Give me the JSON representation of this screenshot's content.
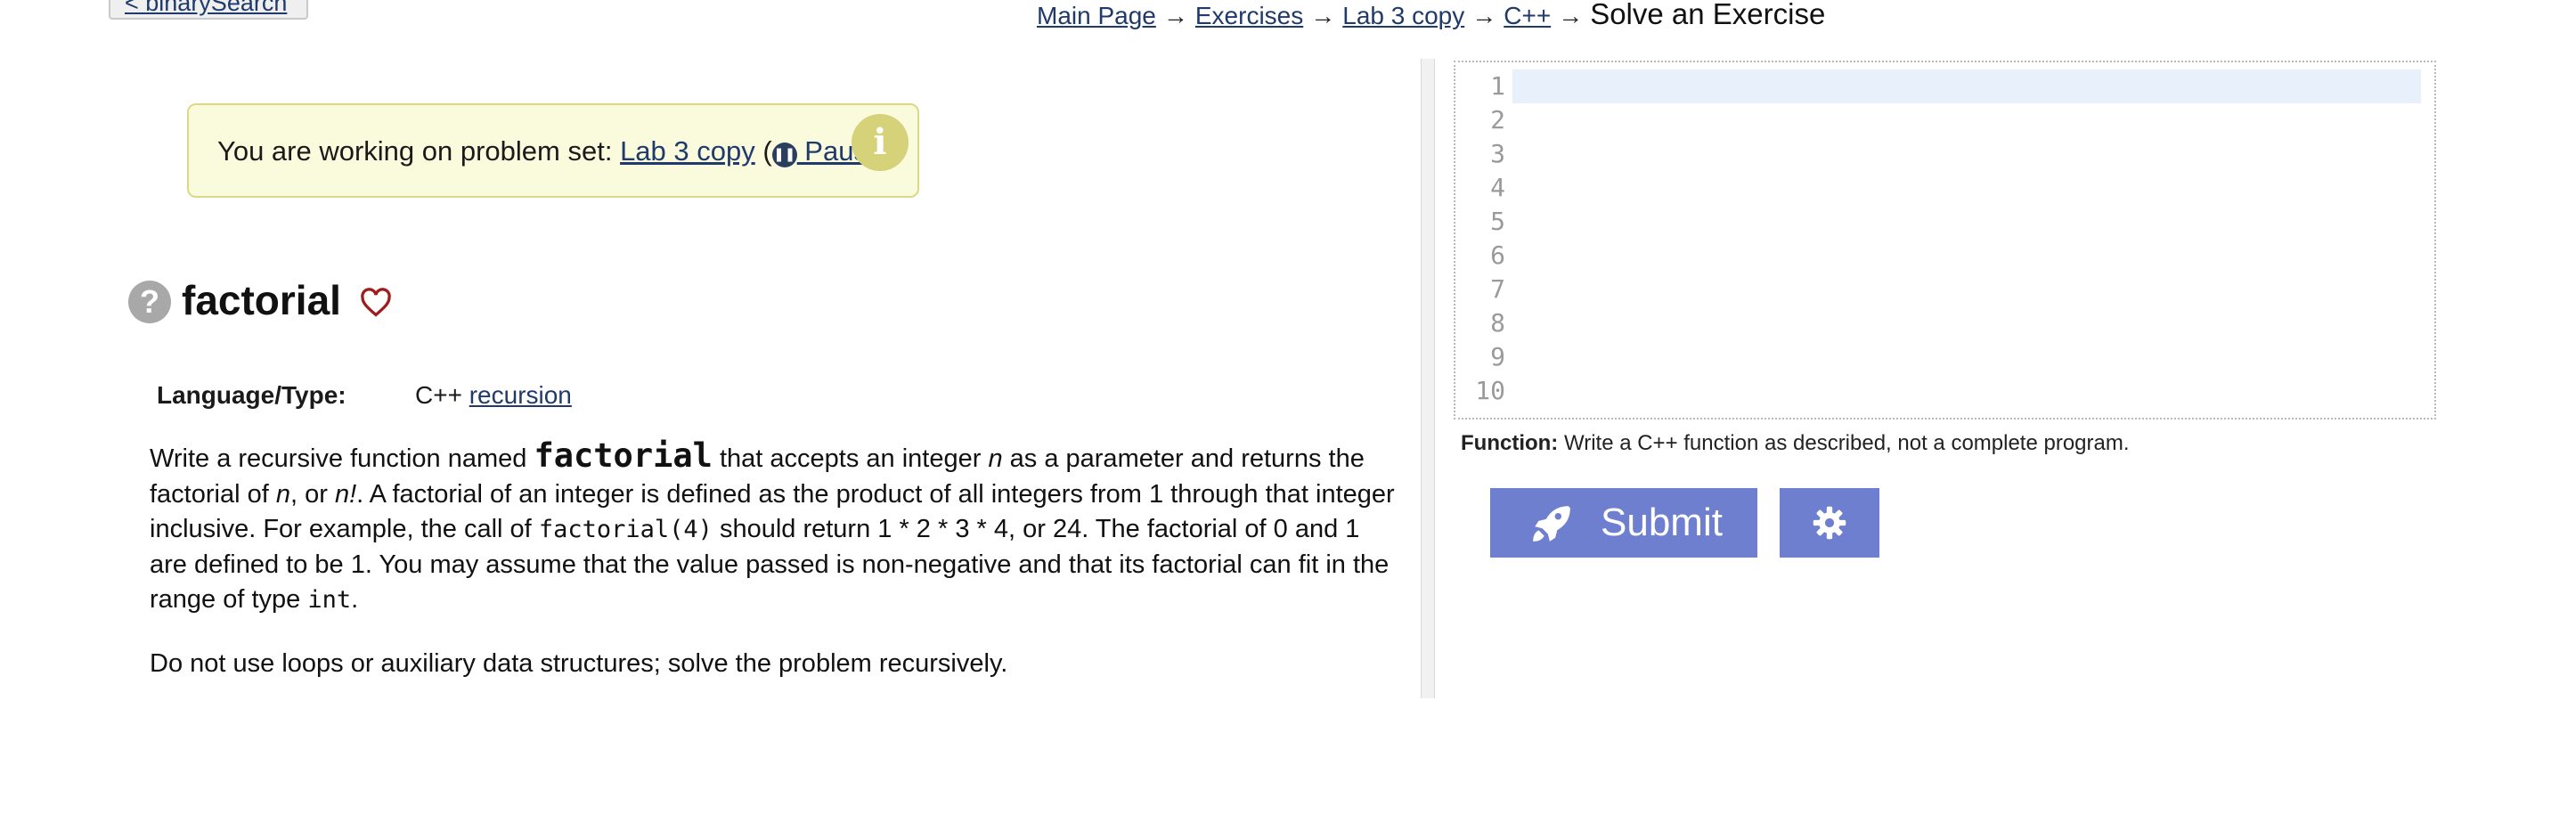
{
  "nav": {
    "prev_label": "< binarySearch"
  },
  "breadcrumb": {
    "items": [
      "Main Page",
      "Exercises",
      "Lab 3 copy",
      "C++"
    ],
    "separator": "→",
    "current": "Solve an Exercise"
  },
  "notice": {
    "prefix": "You are working on problem set: ",
    "set_name": "Lab 3 copy",
    "pause_label": " Pause",
    "open_paren": " (",
    "close_paren": ")",
    "info_icon": "info-icon"
  },
  "problem": {
    "title": "factorial",
    "language_label": "Language/Type:",
    "language": "C++",
    "type_link": "recursion",
    "desc": {
      "s1": "Write a recursive function named ",
      "fn": "factorial",
      "s2": " that accepts an integer ",
      "n1": "n",
      "s3": " as a parameter and returns the factorial of ",
      "n2": "n",
      "s4": ", or ",
      "n3": "n!",
      "s5": ". A factorial of an integer is defined as the product of all integers from 1 through that integer inclusive. For example, the call of ",
      "call": "factorial(4)",
      "s6": " should return 1 * 2 * 3 * 4, or 24. The factorial of 0 and 1 are defined to be 1. You may assume that the value passed is non-negative and that its factorial can fit in the range of type ",
      "type": "int",
      "s7": "."
    },
    "note": "Do not use loops or auxiliary data structures; solve the problem recursively."
  },
  "editor": {
    "line_numbers": [
      "1",
      "2",
      "3",
      "4",
      "5",
      "6",
      "7",
      "8",
      "9",
      "10"
    ],
    "hint_label": "Function:",
    "hint_text": " Write a C++ function as described, not a complete program."
  },
  "actions": {
    "submit_label": "Submit"
  },
  "colors": {
    "accent": "#6f7fcf",
    "notice_bg": "#fafadc",
    "link": "#1f3a6b",
    "heart": "#a01c1c"
  }
}
